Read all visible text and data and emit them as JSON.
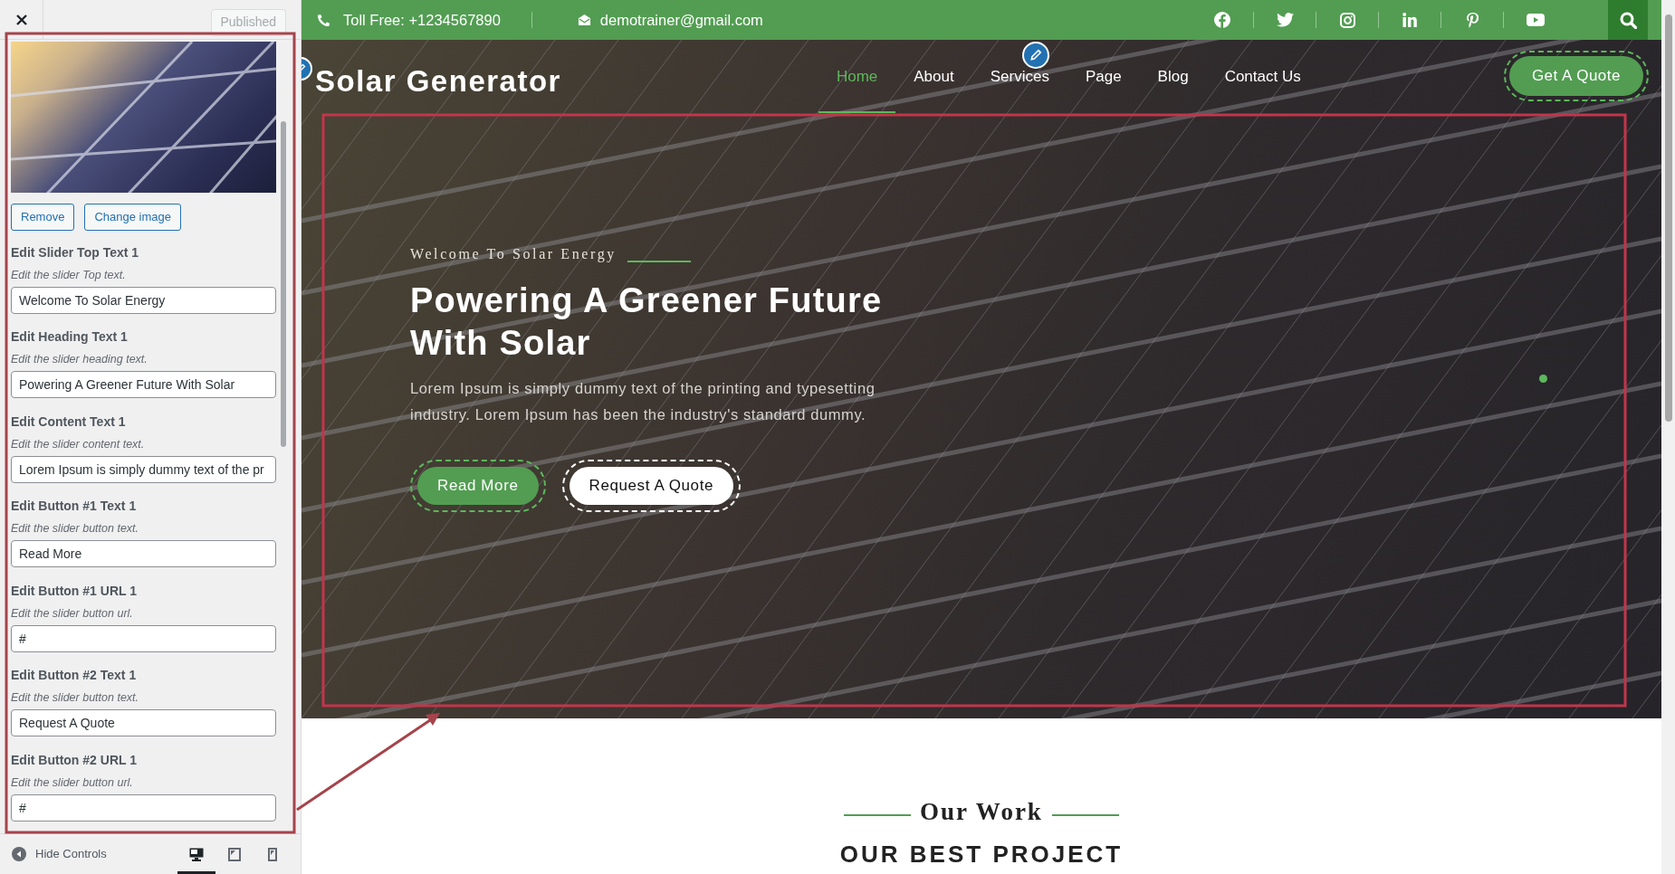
{
  "customizer": {
    "publish_button": "Published",
    "image_buttons": [
      "Remove",
      "Change image"
    ],
    "fields": [
      {
        "label": "Edit Slider Top Text 1",
        "description": "Edit the slider Top text.",
        "value": "Welcome To Solar Energy"
      },
      {
        "label": "Edit Heading Text 1",
        "description": "Edit the slider heading text.",
        "value": "Powering A Greener Future With Solar"
      },
      {
        "label": "Edit Content Text 1",
        "description": "Edit the slider content text.",
        "value": "Lorem Ipsum is simply dummy text of the pr"
      },
      {
        "label": "Edit Button #1 Text 1",
        "description": "Edit the slider button text.",
        "value": "Read More"
      },
      {
        "label": "Edit Button #1 URL 1",
        "description": "Edit the slider button url.",
        "value": "#"
      },
      {
        "label": "Edit Button #2 Text 1",
        "description": "Edit the slider button text.",
        "value": "Request A Quote"
      },
      {
        "label": "Edit Button #2 URL 1",
        "description": "Edit the slider button url.",
        "value": "#"
      }
    ],
    "hide_controls": "Hide Controls",
    "devices": [
      {
        "kind": "desktop",
        "selected": true
      },
      {
        "kind": "tablet",
        "selected": false
      },
      {
        "kind": "mobile",
        "selected": false
      }
    ]
  },
  "site": {
    "topbar": {
      "phone": "Toll Free: +1234567890",
      "email": "demotrainer@gmail.com",
      "social": [
        {
          "kind": "facebook"
        },
        {
          "kind": "twitter"
        },
        {
          "kind": "instagram"
        },
        {
          "kind": "linkedin"
        },
        {
          "kind": "pinterest"
        },
        {
          "kind": "youtube"
        }
      ]
    },
    "logo": "Solar Generator",
    "nav": [
      {
        "label": "Home",
        "selected": true
      },
      {
        "label": "About",
        "selected": false
      },
      {
        "label": "Services",
        "selected": false
      },
      {
        "label": "Page",
        "selected": false
      },
      {
        "label": "Blog",
        "selected": false
      },
      {
        "label": "Contact Us",
        "selected": false
      }
    ],
    "quote_button": "Get A Quote",
    "hero": {
      "top_text": "Welcome To Solar Energy",
      "heading": "Powering A Greener Future With Solar",
      "text": "Lorem Ipsum is simply dummy text of the printing and typesetting industry. Lorem Ipsum has been the industry's standard dummy.",
      "buttons": [
        {
          "label": "Read More",
          "kind": "primary"
        },
        {
          "label": "Request A Quote",
          "kind": "secondary"
        }
      ]
    },
    "section": {
      "subtitle": "Our Work",
      "title": "OUR BEST PROJECT"
    }
  }
}
